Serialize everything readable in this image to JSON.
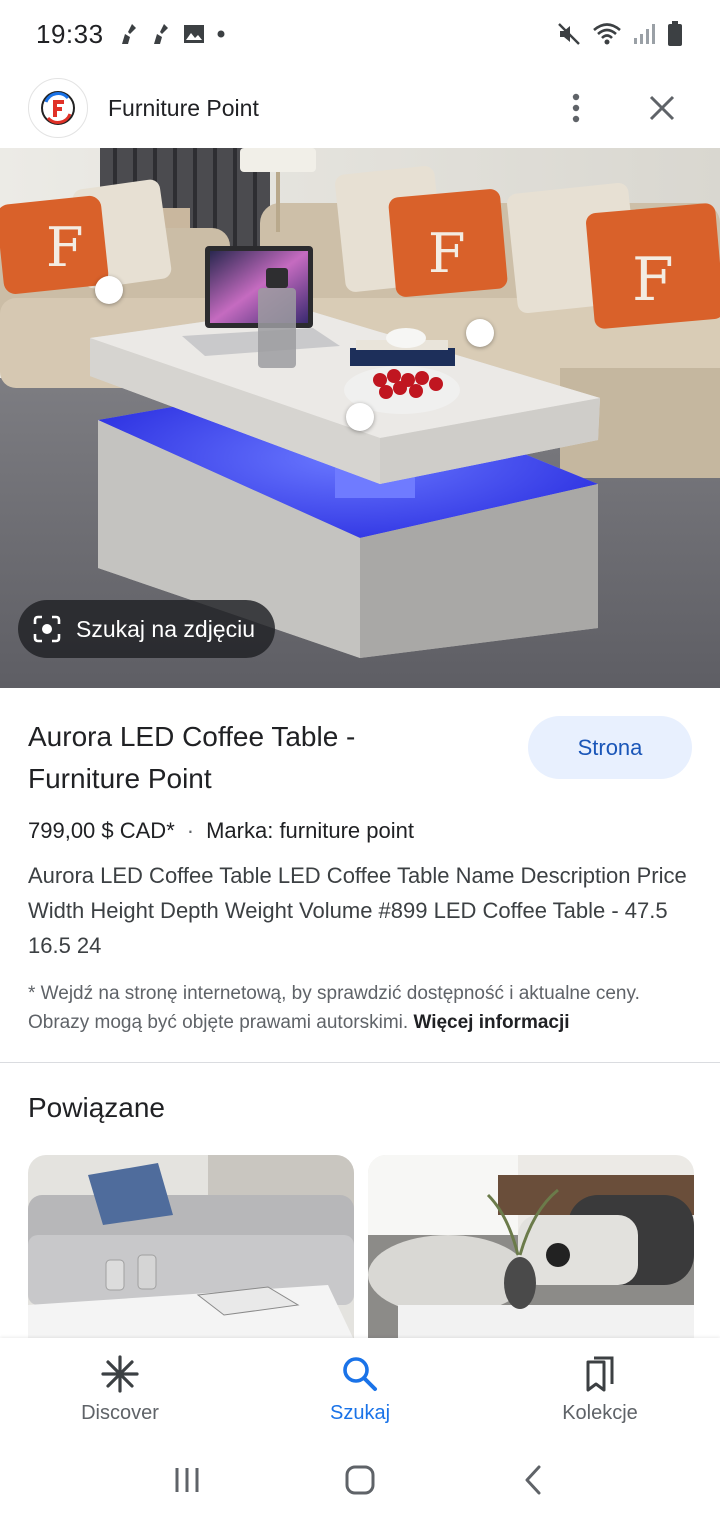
{
  "status_bar": {
    "time": "19:33",
    "left_icons": [
      "broom-icon",
      "broom-icon",
      "gallery-icon",
      "dot-icon"
    ],
    "right_icons": [
      "mute-icon",
      "wifi-icon",
      "signal-icon",
      "battery-icon"
    ]
  },
  "header": {
    "site_name": "Furniture Point",
    "logo_icon": "furniture-point-logo",
    "more_icon": "more-vert-icon",
    "close_icon": "close-icon"
  },
  "hero": {
    "lens_label": "Szukaj na zdjęciu",
    "lens_icon": "lens-icon"
  },
  "product": {
    "title": "Aurora LED Coffee Table - Furniture Point",
    "visit_label": "Strona",
    "price": "799,00 $ CAD*",
    "separator": "·",
    "brand": "Marka: furniture point",
    "description": "Aurora LED Coffee Table LED Coffee Table Name Description Price Width Height Depth Weight Volume #899 LED Coffee Table - 47.5 16.5 24",
    "disclaimer": "* Wejdź na stronę internetową, by sprawdzić dostępność i aktualne ceny. Obrazy mogą być objęte prawami autorskimi.",
    "more_info": "Więcej informacji"
  },
  "related": {
    "title": "Powiązane"
  },
  "bottom_nav": {
    "items": [
      {
        "label": "Discover",
        "icon": "asterisk-icon"
      },
      {
        "label": "Szukaj",
        "icon": "search-icon"
      },
      {
        "label": "Kolekcje",
        "icon": "collections-icon"
      }
    ],
    "active_index": 1
  },
  "system_nav": {
    "icons": [
      "recents-icon",
      "home-icon",
      "back-icon"
    ]
  },
  "colors": {
    "accent_blue": "#1a73e8",
    "button_bg": "#e8f0fe",
    "button_text": "#1a56b8",
    "led_blue": "#4a5cff",
    "pillow_orange": "#d9612a"
  }
}
